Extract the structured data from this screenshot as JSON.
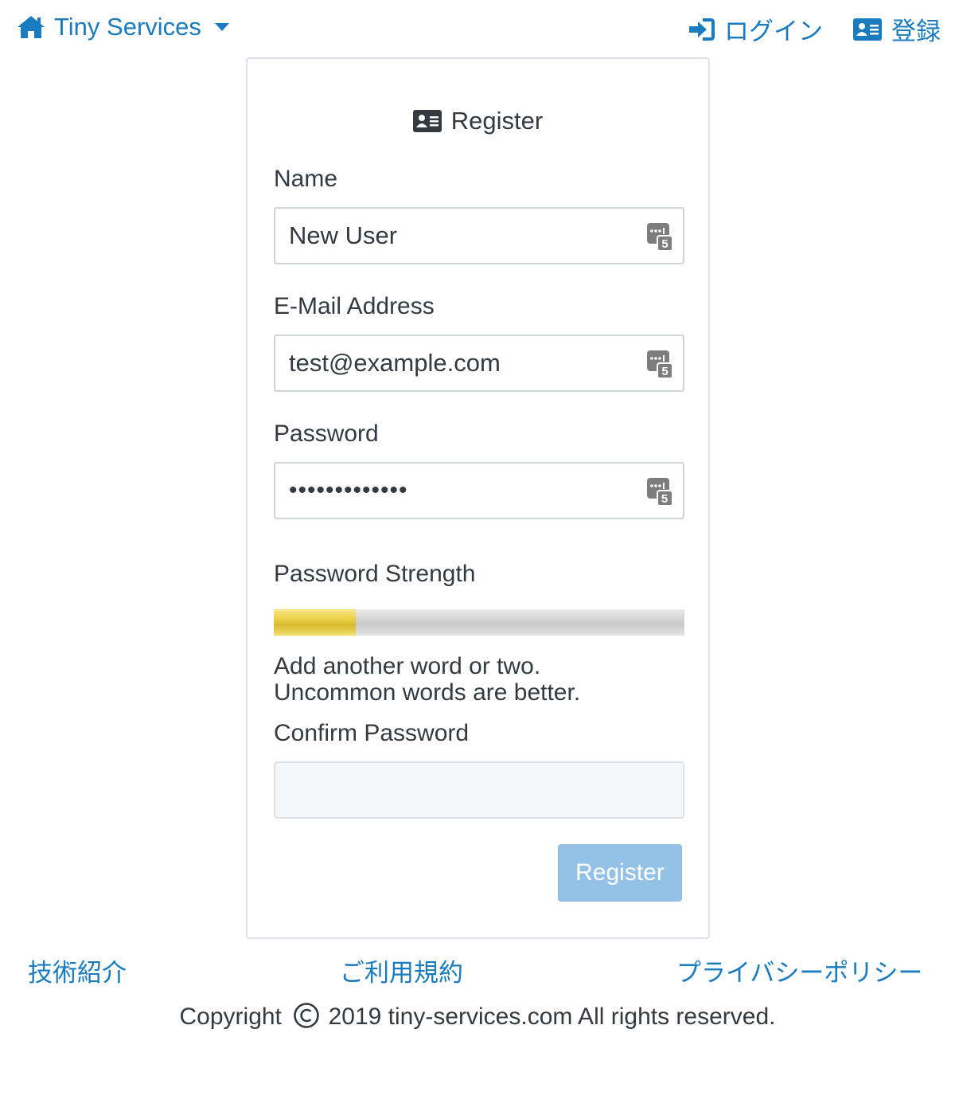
{
  "navbar": {
    "brand": "Tiny Services",
    "login": "ログイン",
    "register": "登録"
  },
  "form": {
    "title": "Register",
    "name_label": "Name",
    "name_value": "New User",
    "email_label": "E-Mail Address",
    "email_value": "test@example.com",
    "password_label": "Password",
    "password_value": "•••••••••••••",
    "strength_label": "Password Strength",
    "strength_level": 0.2,
    "hint_line1": "Add another word or two.",
    "hint_line2": "Uncommon words are better.",
    "confirm_label": "Confirm Password",
    "confirm_value": "",
    "submit": "Register",
    "field_badge_number": "5"
  },
  "footer": {
    "tech": "技術紹介",
    "terms": "ご利用規約",
    "privacy": "プライバシーポリシー",
    "copyright_prefix": "Copyright",
    "copyright_rest": "2019 tiny-services.com All rights reserved."
  },
  "colors": {
    "link": "#1a7bbf",
    "text": "#343a40",
    "button_disabled": "#94c1e6",
    "strength_fill": "#ecd34a"
  },
  "icons": {
    "brand": "home-icon",
    "caret": "caret-down-icon",
    "login": "sign-in-icon",
    "register": "id-card-icon",
    "field_badge": "password-manager-icon"
  }
}
